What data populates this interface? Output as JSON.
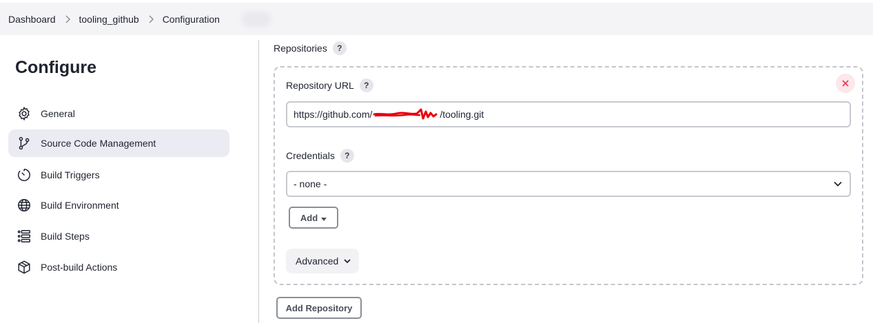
{
  "breadcrumb": {
    "items": [
      "Dashboard",
      "tooling_github",
      "Configuration"
    ]
  },
  "sidebar": {
    "title": "Configure",
    "items": [
      {
        "label": "General",
        "icon": "gear-icon",
        "active": false
      },
      {
        "label": "Source Code Management",
        "icon": "git-branch-icon",
        "active": true
      },
      {
        "label": "Build Triggers",
        "icon": "timer-icon",
        "active": false
      },
      {
        "label": "Build Environment",
        "icon": "globe-icon",
        "active": false
      },
      {
        "label": "Build Steps",
        "icon": "list-icon",
        "active": false
      },
      {
        "label": "Post-build Actions",
        "icon": "package-icon",
        "active": false
      }
    ]
  },
  "main": {
    "repositories_label": "Repositories",
    "help_glyph": "?",
    "repository_url_label": "Repository URL",
    "repository_url_prefix": "https://github.com/",
    "repository_url_suffix": "/tooling.git",
    "credentials_label": "Credentials",
    "credentials_selected": "- none -",
    "add_label": "Add",
    "advanced_label": "Advanced",
    "add_repository_label": "Add Repository"
  },
  "colors": {
    "accent_active_bg": "#ebebf3",
    "delete_red": "#e43c4f",
    "redaction_red": "#e8000b"
  }
}
